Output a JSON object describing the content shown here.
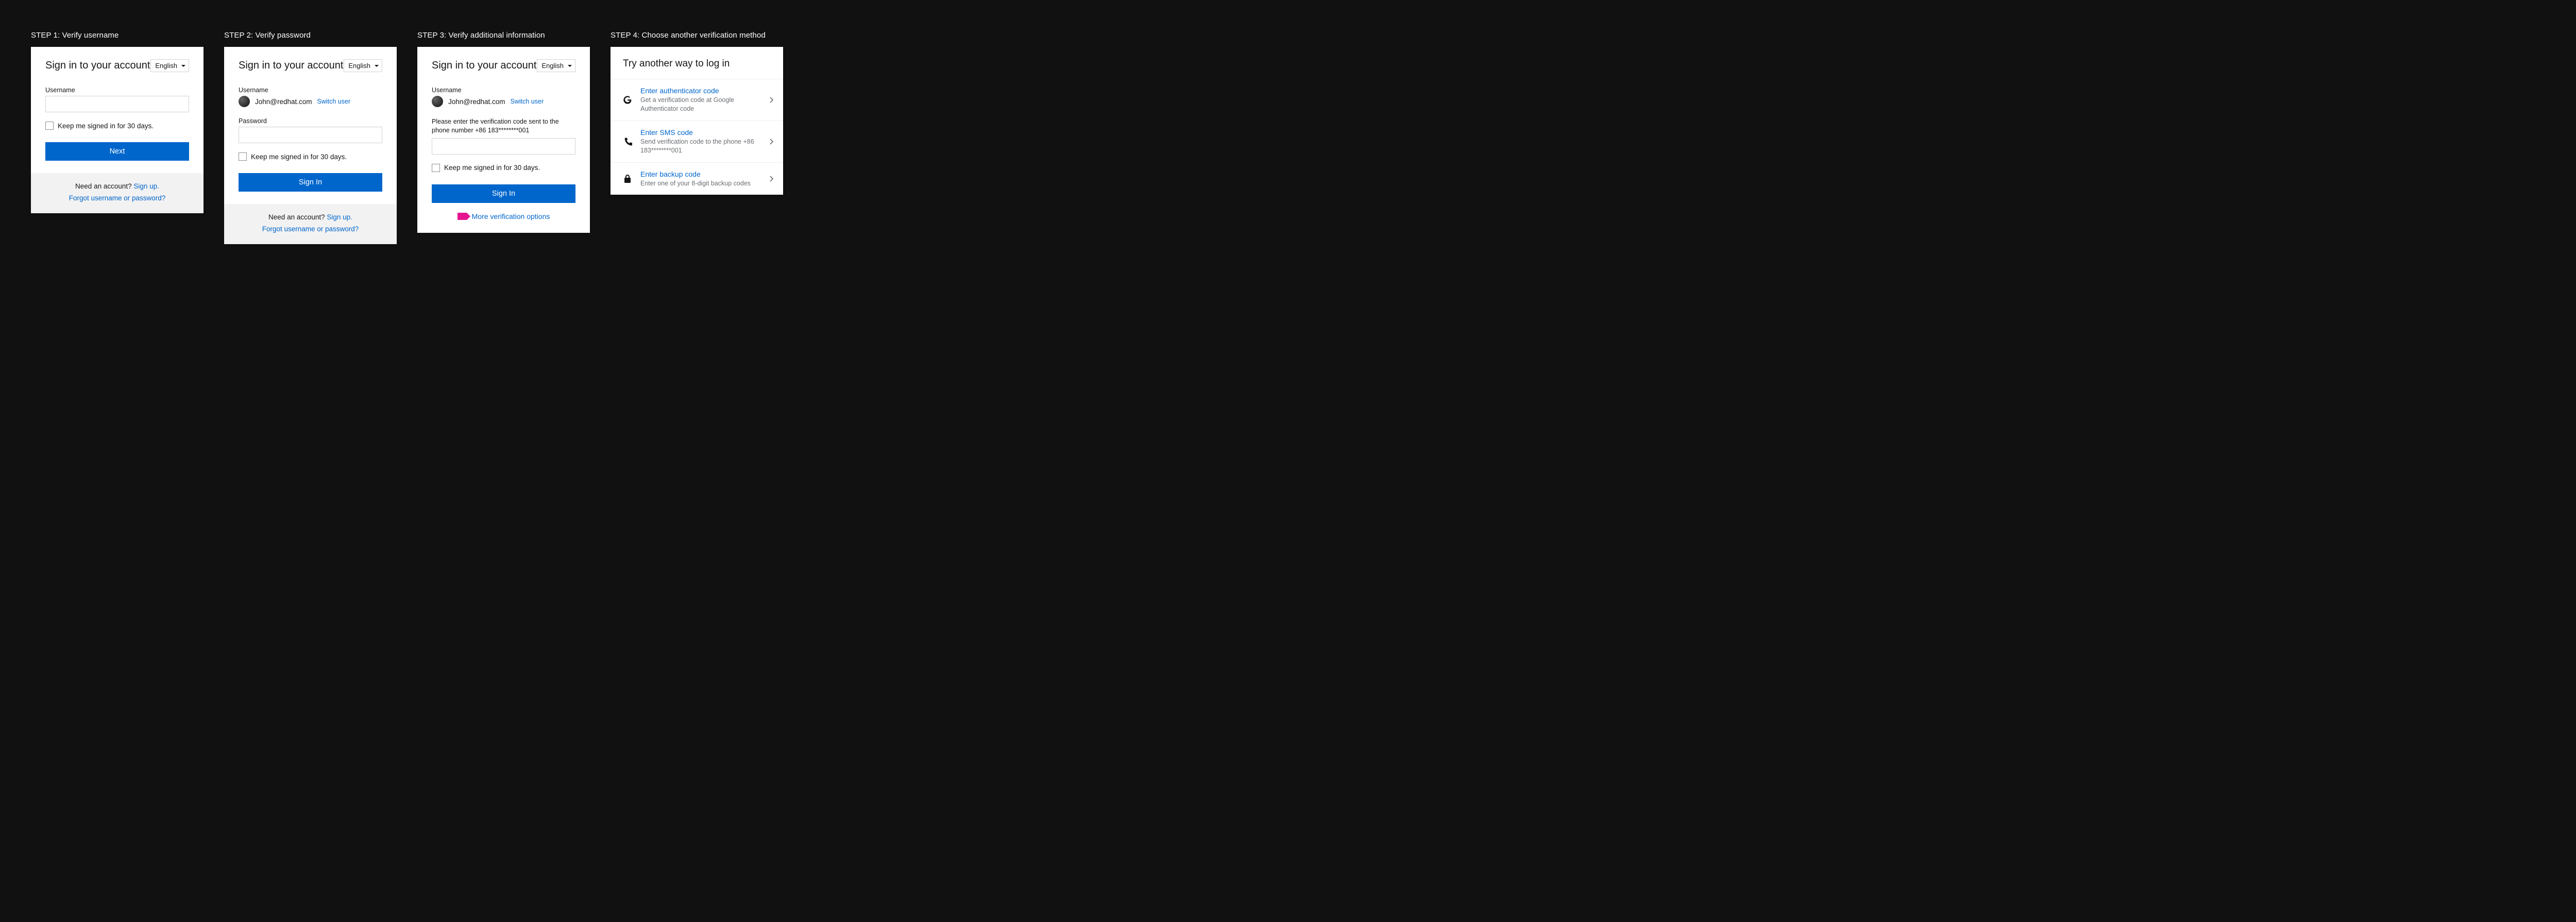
{
  "colors": {
    "primary": "#0066cc",
    "accent_pink": "#e5168f",
    "text": "#151515"
  },
  "steps": {
    "s1": {
      "label": "STEP 1: Verify username",
      "title": "Sign in to your account",
      "language": "English",
      "username_label": "Username",
      "username_value": "",
      "keep_signed": "Keep me signed in for 30 days.",
      "button": "Next",
      "need_account": "Need an account?",
      "signup": "Sign up.",
      "forgot": "Forgot username or password?"
    },
    "s2": {
      "label": "STEP 2: Verify password",
      "title": "Sign in to your account",
      "language": "English",
      "username_label": "Username",
      "user_email": "John@redhat.com",
      "switch_user": "Switch user",
      "password_label": "Password",
      "password_value": "",
      "keep_signed": "Keep me signed in for 30 days.",
      "button": "Sign In",
      "need_account": "Need an account?",
      "signup": "Sign up.",
      "forgot": "Forgot username or password?"
    },
    "s3": {
      "label": "STEP 3: Verify additional information",
      "title": "Sign in to your account",
      "language": "English",
      "username_label": "Username",
      "user_email": "John@redhat.com",
      "switch_user": "Switch user",
      "code_hint": "Please enter the verification code sent to the phone number +86 183********001",
      "code_value": "",
      "keep_signed": "Keep me signed in for 30 days.",
      "button": "Sign In",
      "more_options": "More verification options"
    },
    "s4": {
      "label": "STEP 4: Choose another verification method",
      "title": "Try another way to log in",
      "methods": [
        {
          "icon": "google",
          "title": "Enter authenticator code",
          "desc": "Get a verification code at Google Authenticator code"
        },
        {
          "icon": "phone",
          "title": "Enter SMS code",
          "desc": "Send verification code to the phone +86 183********001"
        },
        {
          "icon": "lock",
          "title": "Enter backup code",
          "desc": "Enter one of your 8-digit backup codes"
        }
      ]
    }
  }
}
